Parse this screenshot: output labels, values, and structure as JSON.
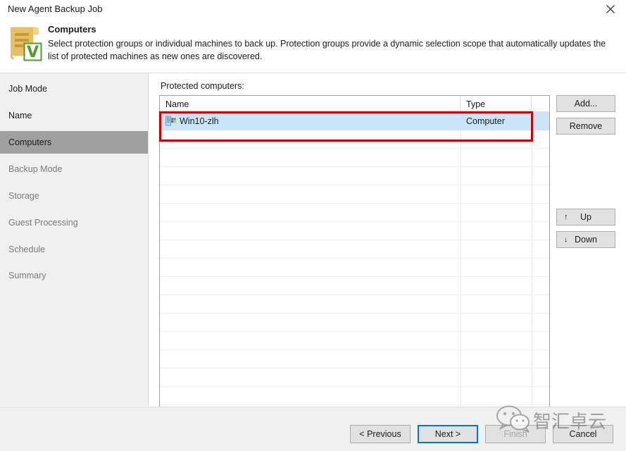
{
  "window": {
    "title": "New Agent Backup Job",
    "close_icon": "close-icon"
  },
  "header": {
    "icon": "backup-job-document-icon",
    "title": "Computers",
    "description": "Select protection groups or individual machines to back up. Protection groups provide a dynamic selection scope that automatically updates the list of protected machines as new ones are discovered."
  },
  "sidebar": {
    "items": [
      {
        "label": "Job Mode",
        "state": "done"
      },
      {
        "label": "Name",
        "state": "done"
      },
      {
        "label": "Computers",
        "state": "active"
      },
      {
        "label": "Backup Mode",
        "state": "pending"
      },
      {
        "label": "Storage",
        "state": "pending"
      },
      {
        "label": "Guest Processing",
        "state": "pending"
      },
      {
        "label": "Schedule",
        "state": "pending"
      },
      {
        "label": "Summary",
        "state": "pending"
      }
    ]
  },
  "main": {
    "list_label": "Protected computers:",
    "columns": [
      "Name",
      "Type",
      ""
    ],
    "rows": [
      {
        "name": "Win10-zlh",
        "type": "Computer",
        "icon": "computer-tiles-icon",
        "selected": true
      }
    ],
    "buttons": {
      "add": "Add...",
      "remove": "Remove",
      "up": "Up",
      "down": "Down",
      "up_arrow": "↑",
      "down_arrow": "↓"
    }
  },
  "footer": {
    "previous": "< Previous",
    "next": "Next >",
    "finish": "Finish",
    "cancel": "Cancel"
  },
  "watermark": {
    "text": "智汇卓云",
    "icon": "wechat-logo-icon"
  },
  "colors": {
    "selection_blue": "#cce4f7",
    "annotation_red": "#cc0000",
    "sidebar_active_gray": "#a0a0a0",
    "focus_blue": "#0078d7",
    "panel_gray": "#f0f0f0"
  }
}
